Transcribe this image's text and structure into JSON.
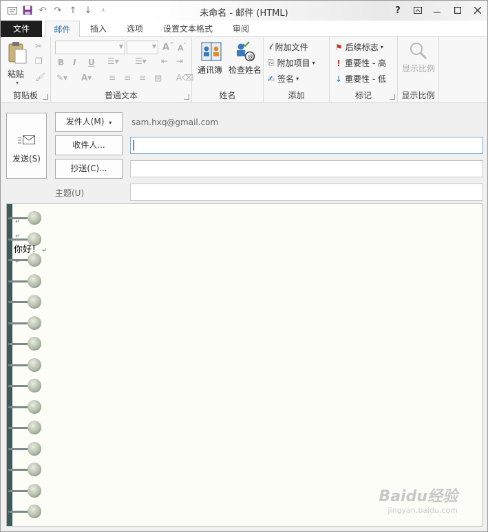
{
  "window": {
    "title": "未命名 - 邮件 (HTML)",
    "help": "?",
    "controls": [
      "restore-ribbon",
      "minimize",
      "maximize",
      "close"
    ]
  },
  "qat": [
    "save",
    "undo",
    "redo",
    "up",
    "down",
    "customize"
  ],
  "tabs": [
    {
      "label": "文件",
      "active": false
    },
    {
      "label": "邮件",
      "active": true
    },
    {
      "label": "插入",
      "active": false
    },
    {
      "label": "选项",
      "active": false
    },
    {
      "label": "设置文本格式",
      "active": false
    },
    {
      "label": "审阅",
      "active": false
    }
  ],
  "ribbon": {
    "clipboard": {
      "paste": "粘贴",
      "group": "剪贴板"
    },
    "basic_text": {
      "bold": "B",
      "italic": "I",
      "underline": "U",
      "font_color": "A",
      "group": "普通文本"
    },
    "names": {
      "address_book": "通讯簿",
      "check_names": "检查姓名",
      "group": "姓名"
    },
    "include": {
      "attach_file": "附加文件",
      "attach_item": "附加项目",
      "signature": "签名",
      "group": "添加"
    },
    "tags": {
      "follow_up": "后续标志",
      "high": "重要性 - 高",
      "low": "重要性 - 低",
      "group": "标记"
    },
    "zoom": {
      "zoom": "显示比例",
      "group": "显示比例"
    }
  },
  "compose": {
    "send": "发送(S)",
    "from_button": "发件人(M)",
    "from_value": "sam.hxq@gmail.com",
    "to_button": "收件人...",
    "cc_button": "抄送(C)...",
    "subject_label": "主题(U)",
    "to_value": "",
    "cc_value": "",
    "subject_value": ""
  },
  "body": {
    "para_mark": "↵",
    "greeting": "你好！"
  },
  "watermark": {
    "brand": "Baidu经验",
    "url": "jingyan.baidu.com"
  },
  "colors": {
    "accent": "#2a6fb5",
    "file_tab": "#1e1e1e",
    "flag": "#c0392b",
    "high": "#c0392b",
    "low": "#2a6fb5",
    "spine": "#3b5a5a"
  }
}
